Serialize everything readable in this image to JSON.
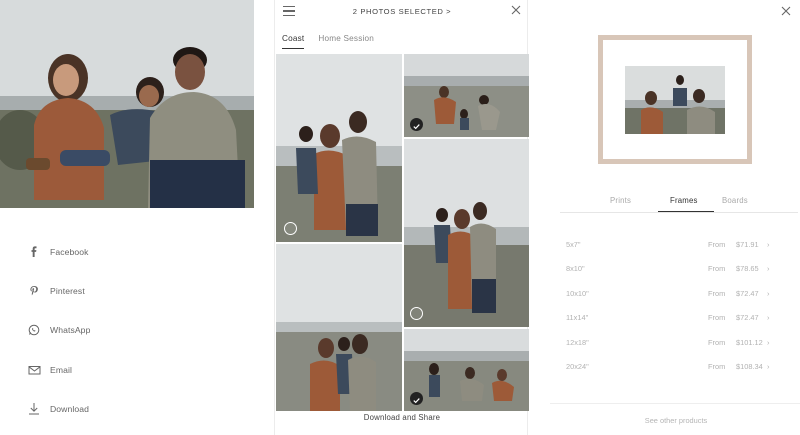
{
  "share": {
    "items": [
      {
        "label": "Facebook",
        "icon": "facebook-icon"
      },
      {
        "label": "Pinterest",
        "icon": "pinterest-icon"
      },
      {
        "label": "WhatsApp",
        "icon": "whatsapp-icon"
      },
      {
        "label": "Email",
        "icon": "email-icon"
      },
      {
        "label": "Download",
        "icon": "download-icon"
      }
    ]
  },
  "gallery": {
    "title": "2 PHOTOS SELECTED >",
    "tabs": [
      {
        "label": "Coast",
        "active": true
      },
      {
        "label": "Home Session",
        "active": false
      }
    ],
    "photos": [
      {
        "selected": false
      },
      {
        "selected": true
      },
      {
        "selected": false
      },
      {
        "selected": false
      },
      {
        "selected": true
      }
    ],
    "footer": "Download and Share"
  },
  "product": {
    "tabs": [
      {
        "label": "Prints",
        "active": false
      },
      {
        "label": "Frames",
        "active": true
      },
      {
        "label": "Boards",
        "active": false
      }
    ],
    "sizes": [
      {
        "size": "5x7\"",
        "from": "From",
        "price": "$71.91"
      },
      {
        "size": "8x10\"",
        "from": "From",
        "price": "$78.65"
      },
      {
        "size": "10x10\"",
        "from": "From",
        "price": "$72.47"
      },
      {
        "size": "11x14\"",
        "from": "From",
        "price": "$72.47"
      },
      {
        "size": "12x18\"",
        "from": "From",
        "price": "$101.12"
      },
      {
        "size": "20x24\"",
        "from": "From",
        "price": "$108.34"
      }
    ],
    "see_other": "See other products",
    "frame_color": "#d8c6b8"
  }
}
